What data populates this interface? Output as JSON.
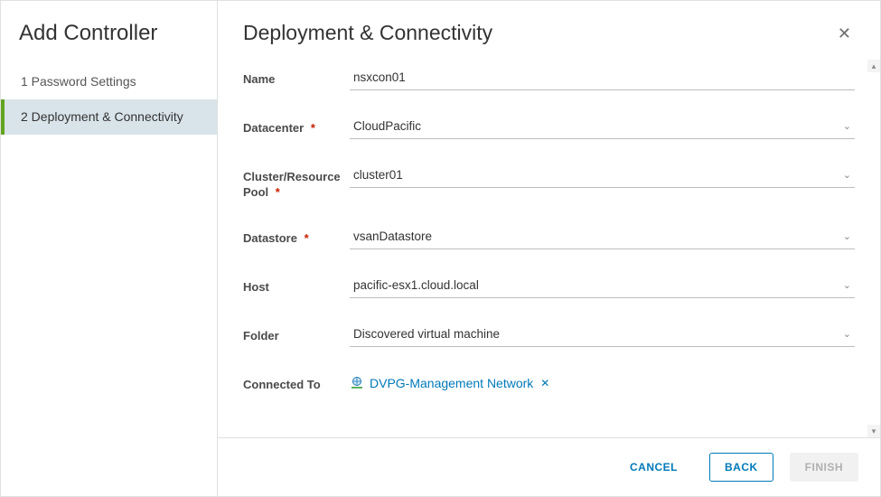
{
  "sidebar": {
    "title": "Add Controller",
    "steps": [
      {
        "label": "1 Password Settings"
      },
      {
        "label": "2 Deployment & Connectivity"
      }
    ]
  },
  "header": {
    "title": "Deployment & Connectivity"
  },
  "form": {
    "name": {
      "label": "Name",
      "value": "nsxcon01"
    },
    "datacenter": {
      "label": "Datacenter",
      "value": "CloudPacific"
    },
    "cluster": {
      "label": "Cluster/Resource Pool",
      "value": "cluster01"
    },
    "datastore": {
      "label": "Datastore",
      "value": "vsanDatastore"
    },
    "host": {
      "label": "Host",
      "value": "pacific-esx1.cloud.local"
    },
    "folder": {
      "label": "Folder",
      "value": "Discovered virtual machine"
    },
    "connected": {
      "label": "Connected To",
      "value": "DVPG-Management Network"
    }
  },
  "footer": {
    "cancel": "CANCEL",
    "back": "BACK",
    "finish": "FINISH"
  },
  "glyphs": {
    "asterisk": "*",
    "close": "✕",
    "remove": "✕"
  }
}
